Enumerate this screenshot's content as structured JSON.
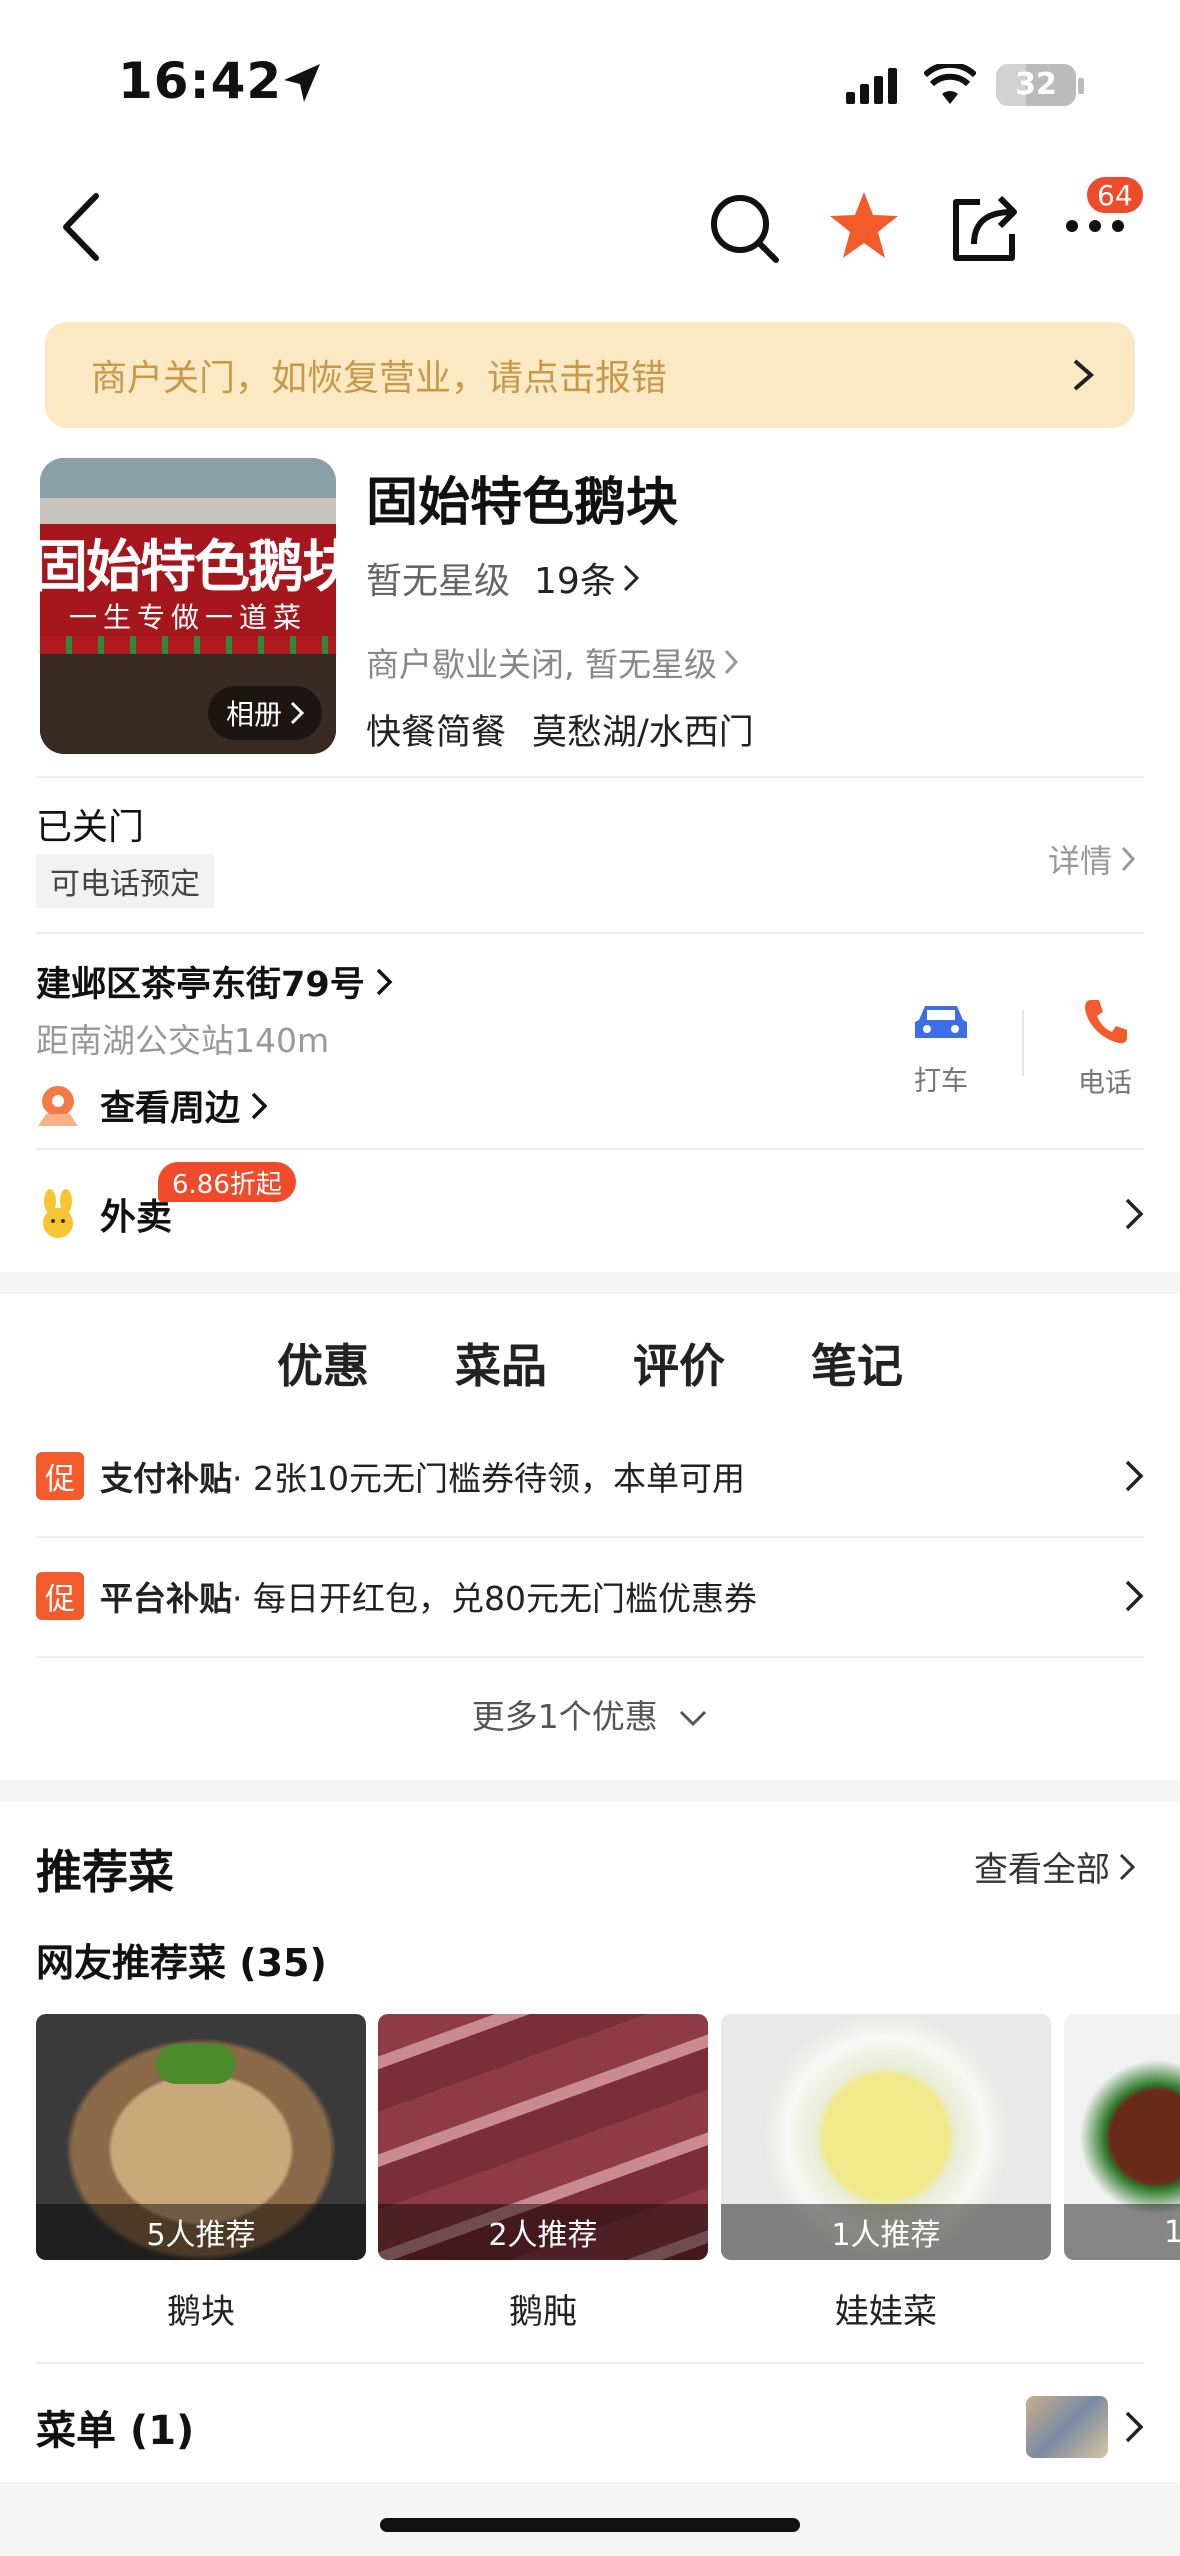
{
  "status_bar": {
    "time": "16:42",
    "battery": "32"
  },
  "nav": {
    "badge_count": "64"
  },
  "banner": {
    "text": "商户关门，如恢复营业，请点击报错"
  },
  "shop": {
    "photo_sign": "固始特色鹅块",
    "photo_slogan": "一生专做一道菜",
    "album_label": "相册",
    "name": "固始特色鹅块",
    "rating": "暂无星级",
    "review_count": "19条",
    "closed_note": "商户歇业关闭, 暂无星级",
    "category": "快餐简餐",
    "area": "莫愁湖/水西门"
  },
  "business": {
    "status": "已关门",
    "booking_tag": "可电话预定",
    "detail_label": "详情"
  },
  "location": {
    "address": "建邺区茶亭东街79号",
    "distance": "距南湖公交站140m",
    "nearby_label": "查看周边",
    "taxi_label": "打车",
    "phone_label": "电话"
  },
  "takeout": {
    "label": "外卖",
    "discount": "6.86折起"
  },
  "tabs": [
    {
      "label": "优惠"
    },
    {
      "label": "菜品"
    },
    {
      "label": "评价"
    },
    {
      "label": "笔记"
    }
  ],
  "promos": [
    {
      "tag": "促",
      "title": "支付补贴",
      "desc": " · 2张10元无门槛券待领，本单可用"
    },
    {
      "tag": "促",
      "title": "平台补贴",
      "desc": " · 每日开红包，兑80元无门槛优惠券"
    }
  ],
  "more_promos": "更多1个优惠",
  "recommended": {
    "title": "推荐菜",
    "view_all": "查看全部",
    "subtitle": "网友推荐菜 (35)",
    "dishes": [
      {
        "name": "鹅块",
        "recommend": "5人推荐"
      },
      {
        "name": "鹅肫",
        "recommend": "2人推荐"
      },
      {
        "name": "娃娃菜",
        "recommend": "1人推荐"
      },
      {
        "name": "",
        "recommend": "1"
      }
    ]
  },
  "menu": {
    "label": "菜单 (1)"
  },
  "colors": {
    "accent": "#f35b2b",
    "banner_bg": "#fbe9c4",
    "banner_text": "#c79a4a",
    "taxi": "#3b6ee8"
  }
}
